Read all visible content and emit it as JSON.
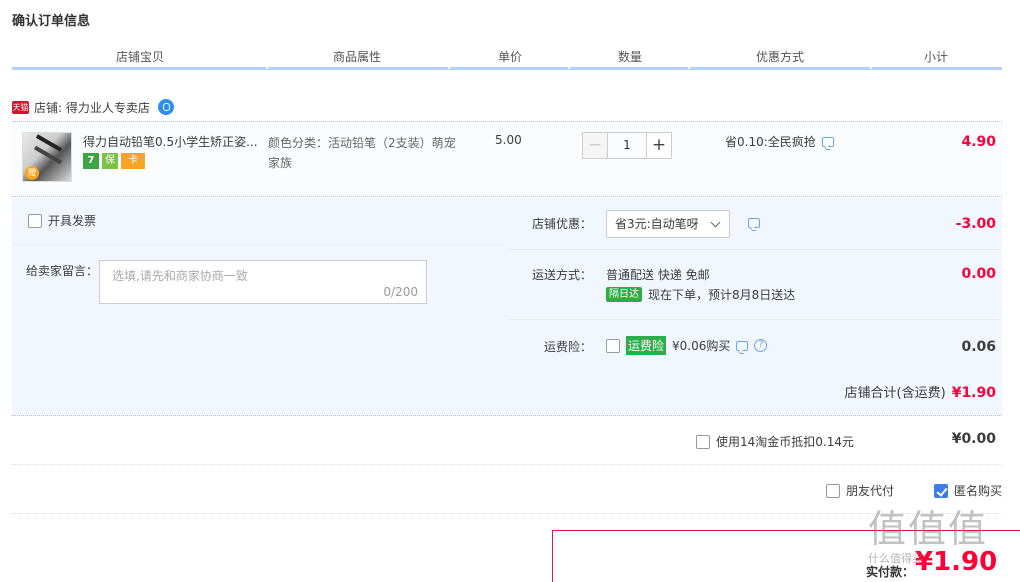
{
  "page": {
    "title": "确认订单信息"
  },
  "columns": [
    "店铺宝贝",
    "商品属性",
    "单价",
    "数量",
    "优惠方式",
    "小计"
  ],
  "shop": {
    "badge": "天猫",
    "label": "店铺: 得力业人专卖店"
  },
  "item": {
    "name": "得力自动铅笔0.5小学生矫正姿...",
    "attr": "颜色分类：活动铅笔（2支装）萌宠家族",
    "price": "5.00",
    "quantity": "1",
    "promo": "省0.10:全民疯抢",
    "subtotal": "4.90",
    "service_icons": [
      "7",
      "保",
      "卡"
    ]
  },
  "invoice": {
    "label": "开具发票",
    "checked": false
  },
  "message": {
    "label": "给卖家留言：",
    "placeholder": "选填,请先和商家协商一致",
    "counter": "0/200"
  },
  "shop_discount": {
    "label": "店铺优惠：",
    "selected": "省3元:自动笔呀",
    "value": "-3.00"
  },
  "shipping": {
    "label": "运送方式：",
    "method": "普通配送 快递 免邮",
    "badge": "隔日达",
    "eta": "现在下单，预计8月8日送达",
    "value": "0.00"
  },
  "insurance": {
    "label": "运费险：",
    "badge": "运费险",
    "price": "¥0.06购买",
    "value": "0.06"
  },
  "shop_total": {
    "label": "店铺合计(含运费)",
    "value": "¥1.90"
  },
  "coins": {
    "label": "使用14淘金币抵扣0.14元",
    "value": "¥0.00"
  },
  "payment_options": {
    "friend_pay": "朋友代付",
    "anonymous": "匿名购买"
  },
  "pay": {
    "label": "实付款：",
    "amount": "¥1.90"
  },
  "watermark": {
    "main": "值值值",
    "sub": "什么值得买"
  },
  "colors": {
    "accent_red": "#ff0036",
    "header_line": "#b2d1ff",
    "panel_bg": "#f2f7ff",
    "tmall_red": "#d3152b",
    "green": "#26b04a"
  }
}
